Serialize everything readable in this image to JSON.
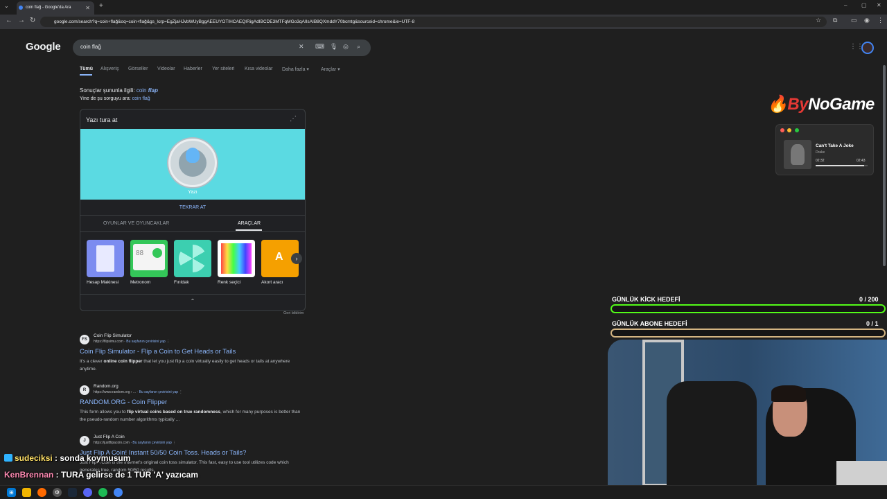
{
  "browser": {
    "tab_title": "coin flağ - Google'da Ara",
    "new_tab": "+",
    "close": "✕",
    "url": "google.com/search?q=coin+flağ&oq=coin+flağ&gs_lcrp=EgZjaHJvbWUyBggAEEUYOTIHCAEQIRigAdIBCDE3MTFqMGo3qAIIsAIB8QXmddY70bcmtg&sourceid=chrome&ie=UTF-8"
  },
  "google": {
    "logo": "Google",
    "query": "coin flağ",
    "nav": [
      "Tümü",
      "Alışveriş",
      "Görseller",
      "Videolar",
      "Haberler",
      "Yer siteleri",
      "Kısa videolar",
      "Daha fazla ▾",
      "Araçlar ▾"
    ],
    "correction_prefix": "Sonuçlar şununla ilgili: ",
    "correction_word1": "coin ",
    "correction_word2": "flap",
    "original_prefix": "Yine de şu sorguyu ara: ",
    "original_query": "coin flağ"
  },
  "coin_card": {
    "title": "Yazı tura at",
    "result": "Yazı",
    "again": "TEKRAR AT",
    "tabs": [
      "OYUNLAR VE OYUNCAKLAR",
      "ARAÇLAR"
    ],
    "tools": [
      "Hesap Makinesi",
      "Metronom",
      "Fırıldak",
      "Renk seçici",
      "Akort aracı"
    ],
    "metronome_value": "88",
    "tuner_letter": "A",
    "feedback": "Geri bildirim"
  },
  "results": [
    {
      "site": "Coin Flip Simulator",
      "url": "https://flipsimu.com",
      "translate": "Bu sayfanın çevirisini yap",
      "title": "Coin Flip Simulator - Flip a Coin to Get Heads or Tails",
      "snippet_pre": "It's a clever ",
      "snippet_bold": "online coin flipper",
      "snippet_post": " that let you just flip a coin virtually easily to get heads or tails at anywhere anytime.",
      "fav": "FS"
    },
    {
      "site": "Random.org",
      "url": "https://www.random.org › ...",
      "translate": "Bu sayfanın çevirisini yap",
      "title": "RANDOM.ORG - Coin Flipper",
      "snippet_pre": "This form allows you to ",
      "snippet_bold": "flip virtual coins based on true randomness",
      "snippet_post": ", which for many purposes is better than the pseudo-random number algorithms typically ...",
      "fav": "R"
    },
    {
      "site": "Just Flip A Coin",
      "url": "https://justflipacoin.com",
      "translate": "Bu sayfanın çevirisini yap",
      "title": "Just Flip A Coin! Instant 50/50 Coin Toss. Heads or Tails?",
      "snippet_pre": "",
      "snippet_bold": "",
      "snippet_post": "Just Flip A Coin is the Internet's original coin toss simulator. This fast, easy to use tool utilizes code which generates true, random 50/50 results.",
      "fav": "J"
    }
  ],
  "overlay": {
    "brand_red": "🔥By",
    "brand_white": "NoGame",
    "song": "Can't Take A Joke",
    "artist": "Drake",
    "time_current": "02:32",
    "time_total": "02:43",
    "progress": 0.93,
    "kick_goal_label": "GÜNLÜK KİCK HEDEFİ",
    "kick_goal_value": "0  / 200",
    "sub_goal_label": "GÜNLÜK ABONE HEDEFİ",
    "sub_goal_value": "0  / 1"
  },
  "chat": [
    {
      "user": "sudeciksi",
      "message": " : sonda koymusum"
    },
    {
      "user": "KenBrennan",
      "message": " : TURA gelirse de 1 TUR 'A' yazıcam"
    }
  ],
  "colors": {
    "accent": "#8ab4f8",
    "kick_green": "#53fc18",
    "cyan": "#5bdae2"
  }
}
